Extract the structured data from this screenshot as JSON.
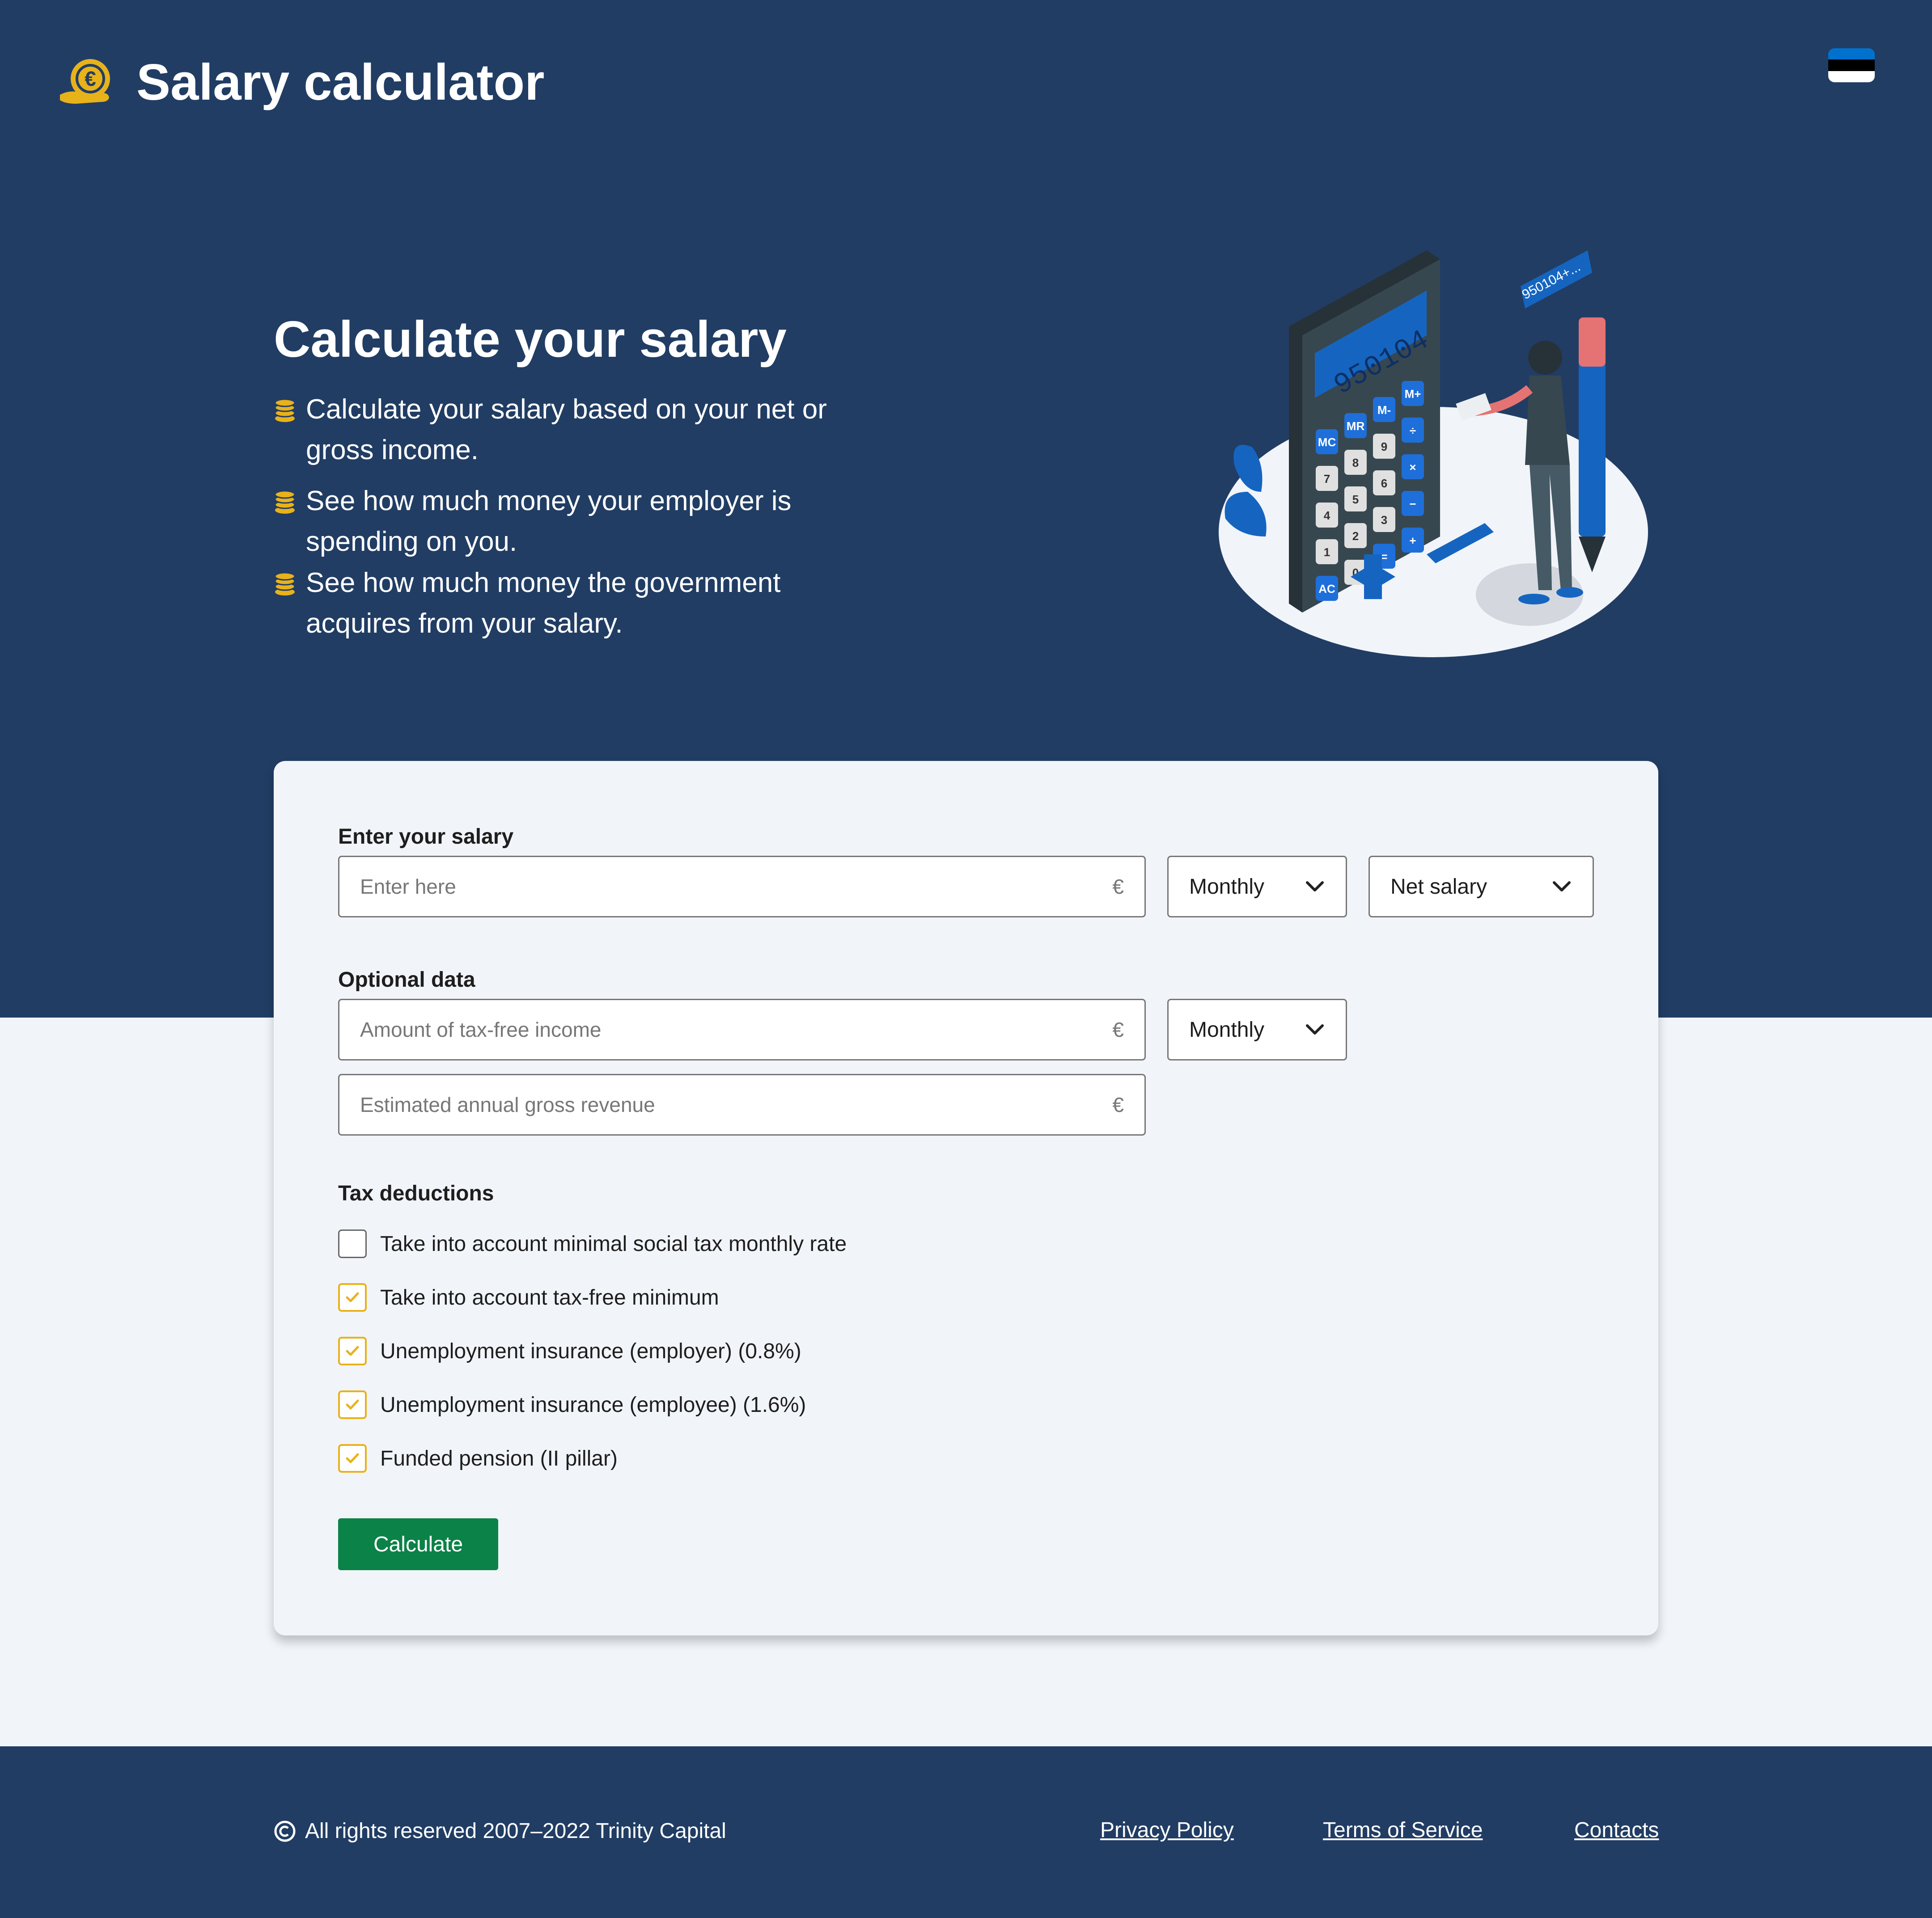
{
  "header": {
    "title": "Salary calculator",
    "logo_icon": "euro-hand-coin-icon",
    "language_flag": "estonia-flag-icon",
    "flag_colors": [
      "#0072CE",
      "#000000",
      "#FFFFFF"
    ]
  },
  "hero": {
    "title": "Calculate your salary",
    "bullets": [
      "Calculate your salary based on your net or gross income.",
      "See how much money your employer is spending on you.",
      "See how much money the government acquires from your salary."
    ],
    "bullet_icon": "coins-icon",
    "illustration": {
      "name": "calculator-person-illustration",
      "display": "950104",
      "speech_bubble": "950104+...",
      "keys": [
        "MC",
        "MR",
        "M-",
        "M+",
        "7",
        "8",
        "9",
        "÷",
        "4",
        "5",
        "6",
        "×",
        "1",
        "2",
        "3",
        "−",
        "AC",
        "0",
        "=",
        "+"
      ]
    }
  },
  "form": {
    "salary": {
      "label": "Enter your salary",
      "placeholder": "Enter here",
      "currency": "€",
      "period": "Monthly",
      "type": "Net salary"
    },
    "optional": {
      "label": "Optional data",
      "tax_free_placeholder": "Amount of tax-free income",
      "tax_free_currency": "€",
      "tax_free_period": "Monthly",
      "revenue_placeholder": "Estimated annual gross revenue",
      "revenue_currency": "€"
    },
    "deductions": {
      "label": "Tax deductions",
      "items": [
        {
          "label": "Take into account minimal social tax monthly rate",
          "checked": false
        },
        {
          "label": "Take into account tax-free minimum",
          "checked": true
        },
        {
          "label": "Unemployment insurance (employer) (0.8%)",
          "checked": true
        },
        {
          "label": "Unemployment insurance (employee) (1.6%)",
          "checked": true
        },
        {
          "label": "Funded pension (II pillar)",
          "checked": true
        }
      ]
    },
    "calculate_label": "Calculate"
  },
  "footer": {
    "copyright": "All rights reserved 2007–2022 Trinity Capital",
    "links": [
      "Privacy Policy",
      "Terms of Service",
      "Contacts"
    ]
  },
  "colors": {
    "navy": "#213D64",
    "background": "#F1F4F9",
    "accent_yellow": "#E8B21A",
    "button_green": "#0B8247",
    "illustration_blue": "#1565C0"
  }
}
